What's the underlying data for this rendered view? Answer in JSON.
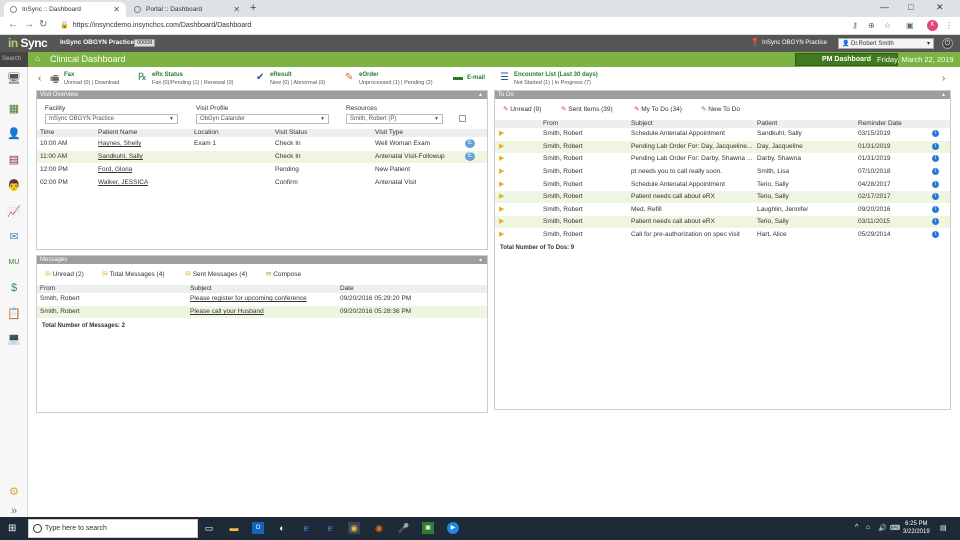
{
  "browser": {
    "tabs": [
      {
        "title": "InSync :: Dashboard"
      },
      {
        "title": "Portal :: Dashboard"
      }
    ],
    "url": "https://insyncdemo.insynchcs.com/Dashboard/Dashboard"
  },
  "app": {
    "logo_part1": "in",
    "logo_part2": "Sync",
    "practice": "InSync OBGYN Practice",
    "practice_code": "00008",
    "location": "InSync OBGYN Practice",
    "doctor": "Dr.Robert Smith",
    "search_placeholder": "Search",
    "page_title": "Clinical Dashboard",
    "pm_dashboard": "PM Dashboard",
    "date": "Friday, March 22, 2019"
  },
  "quickbar": [
    {
      "title": "Fax",
      "sub": "Unread (0) | Download"
    },
    {
      "title": "eRx Status",
      "sub": "Fax (0)/Pending (1) | Renewal (0)"
    },
    {
      "title": "eResult",
      "sub": "New (0) | Abnormal (0)"
    },
    {
      "title": "eOrder",
      "sub": "Unprocessed (1) | Pending (2)"
    },
    {
      "title": "E-mail",
      "sub": ""
    },
    {
      "title": "Encounter List (Last 30 days)",
      "sub": "Not Started (1) | In Progress (7)"
    }
  ],
  "visit_overview": {
    "title": "Visit Overview",
    "facility_label": "Facility",
    "facility_value": "InSync OBGYN Practice",
    "profile_label": "Visit Profile",
    "profile_value": "ObGyn Calander",
    "resources_label": "Resources",
    "resources_value": "Smith, Robert (P)",
    "columns": [
      "Time",
      "Patient Name",
      "Location",
      "Visit Status",
      "Visit Type"
    ],
    "rows": [
      {
        "time": "10:00 AM",
        "patient": "Haynes, Shelly",
        "location": "Exam 1",
        "status": "Check In",
        "type": "Well Woman Exam",
        "etoggle": true
      },
      {
        "time": "11:00 AM",
        "patient": "Sandkuhl, Sally",
        "location": "",
        "status": "Check In",
        "type": "Antenatal Visit-Followup",
        "etoggle": true
      },
      {
        "time": "12:00 PM",
        "patient": "Ford, Gloria",
        "location": "",
        "status": "Pending",
        "type": "New Patient",
        "etoggle": false
      },
      {
        "time": "02:00 PM",
        "patient": "Walker, JESSICA",
        "location": "",
        "status": "Confirm",
        "type": "Antenatal Visit",
        "etoggle": false
      }
    ]
  },
  "messages": {
    "title": "Messages",
    "tabs": [
      {
        "label": "Unread (2)"
      },
      {
        "label": "Total Messages (4)"
      },
      {
        "label": "Sent Messages (4)"
      },
      {
        "label": "Compose"
      }
    ],
    "columns": [
      "From",
      "Subject",
      "Date"
    ],
    "rows": [
      {
        "from": "Smith, Robert",
        "subject": "Please register for upcoming conference",
        "date": "09/20/2016 05:29:20 PM"
      },
      {
        "from": "Smith, Robert",
        "subject": "Please call your Husband",
        "date": "09/20/2016 05:28:36 PM"
      }
    ],
    "total": "Total Number of Messages: 2"
  },
  "todo": {
    "title": "To Do",
    "tabs": [
      {
        "label": "Unread (9)"
      },
      {
        "label": "Sent Items (39)"
      },
      {
        "label": "My To Do (34)"
      },
      {
        "label": "New To Do"
      }
    ],
    "columns": [
      "From",
      "Subject",
      "Patient",
      "Reminder Date"
    ],
    "rows": [
      {
        "from": "Smith, Robert",
        "subject": "Schedule Antenatal Appointment",
        "patient": "Sandkuhl, Sally",
        "date": "03/15/2019"
      },
      {
        "from": "Smith, Robert",
        "subject": "Pending Lab Order For: Day, Jacqueline...",
        "patient": "Day, Jacqueline",
        "date": "01/31/2019"
      },
      {
        "from": "Smith, Robert",
        "subject": "Pending Lab Order For: Darby, Shawna ...",
        "patient": "Darby, Shawna",
        "date": "01/31/2019"
      },
      {
        "from": "Smith, Robert",
        "subject": "pt needs you to call really soon.",
        "patient": "Smith, Lisa",
        "date": "07/10/2018"
      },
      {
        "from": "Smith, Robert",
        "subject": "Schedule Antenatal Appointment",
        "patient": "Terio, Sally",
        "date": "04/28/2017"
      },
      {
        "from": "Smith, Robert",
        "subject": "Patient needs call about eRX",
        "patient": "Terio, Sally",
        "date": "02/17/2017"
      },
      {
        "from": "Smith, Robert",
        "subject": "Med. Refill",
        "patient": "Laughlin, Jennifer",
        "date": "09/20/2016"
      },
      {
        "from": "Smith, Robert",
        "subject": "Patient needs call about eRX",
        "patient": "Terio, Sally",
        "date": "03/11/2015"
      },
      {
        "from": "Smith, Robert",
        "subject": "Call for pre-authorization on spec visit",
        "patient": "Hart, Alice",
        "date": "05/29/2014"
      }
    ],
    "total": "Total Number of To Dos: 9"
  },
  "taskbar": {
    "search_placeholder": "Type here to search",
    "time": "6:25 PM",
    "date": "3/22/2019"
  }
}
